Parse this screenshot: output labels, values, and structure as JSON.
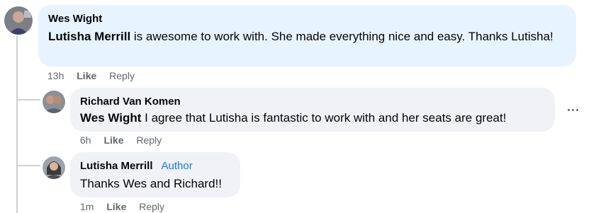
{
  "comments": [
    {
      "author": "Wes Wight",
      "mention": "Lutisha Merrill",
      "text": " is awesome to work with. She made everything nice and easy. Thanks Lutisha!",
      "time": "13h",
      "like_label": "Like",
      "reply_label": "Reply"
    },
    {
      "author": "Richard Van Komen",
      "mention": "Wes Wight",
      "text": " I agree that Lutisha is fantastic to work with and her seats are great!",
      "time": "6h",
      "like_label": "Like",
      "reply_label": "Reply"
    },
    {
      "author": "Lutisha Merrill",
      "badge": "Author",
      "text": "Thanks Wes and Richard!!",
      "time": "1m",
      "like_label": "Like",
      "reply_label": "Reply"
    }
  ],
  "colors": {
    "top_bubble": "#e7f3ff",
    "reply_bubble": "#f0f2f5",
    "meta_text": "#65676b",
    "author_badge": "#1877f2",
    "thread_line": "#ced0d4"
  },
  "icons": {
    "more": "more-options-icon"
  }
}
